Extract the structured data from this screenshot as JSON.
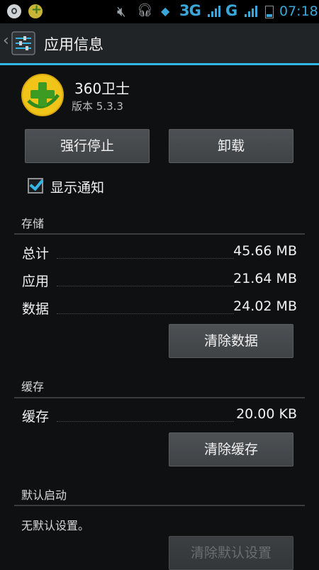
{
  "status_bar": {
    "network_type": "3G",
    "network_type2": "G",
    "time": "07:18"
  },
  "action_bar": {
    "title": "应用信息"
  },
  "app": {
    "name": "360卫士",
    "version": "版本 5.3.3",
    "icon_color": "#f0c419"
  },
  "buttons": {
    "force_stop": "强行停止",
    "uninstall": "卸载",
    "clear_data": "清除数据",
    "clear_cache": "清除缓存",
    "clear_defaults": "清除默认设置"
  },
  "notification": {
    "label": "显示通知",
    "checked": true
  },
  "storage": {
    "header": "存储",
    "rows": [
      {
        "label": "总计",
        "value": "45.66 MB"
      },
      {
        "label": "应用",
        "value": "21.64 MB"
      },
      {
        "label": "数据",
        "value": "24.02 MB"
      }
    ]
  },
  "cache": {
    "header": "缓存",
    "label": "缓存",
    "value": "20.00 KB"
  },
  "default_launch": {
    "header": "默认启动",
    "text": "无默认设置。"
  },
  "colors": {
    "accent": "#33b5e5",
    "background": "#0f1011"
  }
}
